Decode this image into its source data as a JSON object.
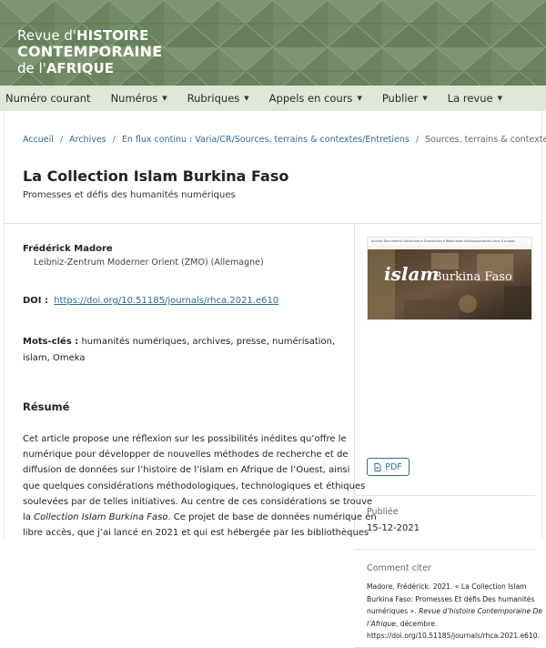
{
  "header": {
    "logo_line1_prefix": "Revue d'",
    "logo_line1_bold": "HISTOIRE",
    "logo_line2": "CONTEMPORAINE",
    "logo_line3_prefix": "de l'",
    "logo_line3_bold": "AFRIQUE",
    "bg_color": "#6f8a62"
  },
  "nav": {
    "items": [
      {
        "label": "Numéro courant",
        "dropdown": false
      },
      {
        "label": "Numéros",
        "dropdown": true
      },
      {
        "label": "Rubriques",
        "dropdown": true
      },
      {
        "label": "Appels en cours",
        "dropdown": true
      },
      {
        "label": "Publier",
        "dropdown": true
      },
      {
        "label": "La revue",
        "dropdown": true
      }
    ],
    "caret": "▼",
    "bg_color": "#dfe7d8"
  },
  "breadcrumb": {
    "items": [
      "Accueil",
      "Archives",
      "En flux continu : Varia/CR/Sources, terrains & contextes/Entretiens"
    ],
    "current": "Sources, terrains & contextes",
    "separator": "/"
  },
  "article": {
    "title": "La Collection Islam Burkina Faso",
    "subtitle": "Promesses et défis des humanités numériques",
    "author": "Frédérick Madore",
    "affiliation": "Leibniz-Zentrum Moderner Orient (ZMO) (Allemagne)",
    "doi_label": "DOI :",
    "doi_value": "https://doi.org/10.51185/journals/rhca.2021.e610",
    "keywords_label": "Mots-clés :",
    "keywords_value": "humanités numériques, archives, presse, numérisation, islam, Omeka",
    "abstract_heading": "Résumé",
    "abstract_lines": [
      "Cet article propose une réflexion sur les possibilités inédites qu’offre le",
      "numérique pour développer de nouvelles méthodes de recherche et de",
      "diffusion de données sur l’histoire de l’islam en Afrique de l’Ouest, ainsi",
      "que quelques considérations méthodologiques, technologiques et éthiques",
      "soulevées par de telles initiatives. Au centre de ces considérations se trouve",
      "Collection Islam Burkina Faso",
      "libre accès, que j’ai lancé en 2021 et qui est hébergée par les bibliothèques"
    ],
    "abstract_line6_prefix": "la ",
    "abstract_line6_suffix": ". Ce projet de base de données numérique en"
  },
  "sidebar": {
    "cover": {
      "nav_text": "Accueil    Documents    Collections ▾    Expositions ▾    Webinaires bibliographiques    Liens    À propos",
      "title_word1": "islam",
      "title_word2": "Burkina Faso"
    },
    "pdf_label": "PDF",
    "published_label": "Publiée",
    "published_date": "15-12-2021",
    "cite_label": "Comment citer",
    "citation_line1": "Madore, Frédérick. 2021. « La Collection Islam",
    "citation_line2": "Burkina Faso: Promesses Et défis Des humanités",
    "citation_line3_prefix": "numériques  ». ",
    "citation_line3_journal": "Revue d’histoire Contemporaine De",
    "citation_line4_journal": "l’Afrique",
    "citation_line4_suffix": ", décembre.",
    "citation_line5": "https://doi.org/10.51185/journals/rhca.2021.e610."
  },
  "colors": {
    "link": "#2c6a9a",
    "header_green": "#6f8a62",
    "nav_bg": "#dfe7d8"
  }
}
